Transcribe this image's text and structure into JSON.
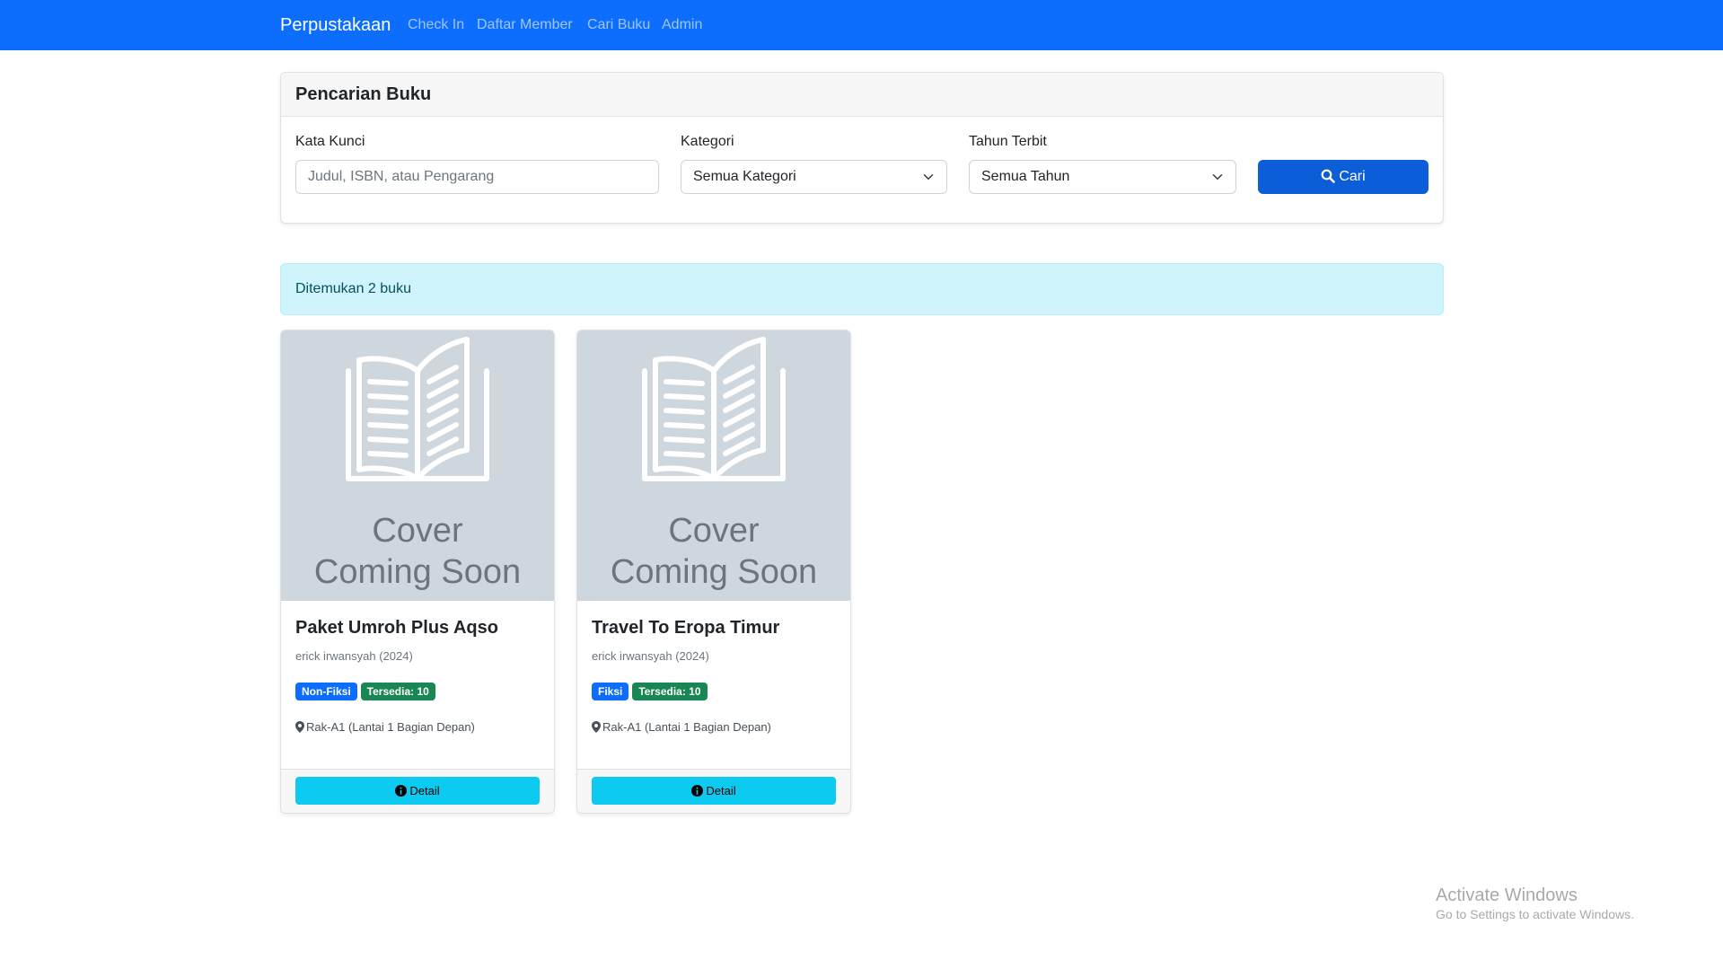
{
  "navbar": {
    "brand": "Perpustakaan",
    "links": [
      "Check In",
      "Daftar Member",
      "Cari Buku",
      "Admin"
    ]
  },
  "search": {
    "header": "Pencarian Buku",
    "keyword_label": "Kata Kunci",
    "keyword_placeholder": "Judul, ISBN, atau Pengarang",
    "keyword_value": "",
    "category_label": "Kategori",
    "category_selected": "Semua Kategori",
    "year_label": "Tahun Terbit",
    "year_selected": "Semua Tahun",
    "button_label": "Cari"
  },
  "result_alert": "Ditemukan 2 buku",
  "books": [
    {
      "cover_line1": "Cover",
      "cover_line2": "Coming Soon",
      "title": "Paket Umroh Plus Aqso",
      "meta": "erick irwansyah (2024)",
      "category": "Non-Fiksi",
      "availability": "Tersedia: 10",
      "location": "Rak-A1 (Lantai 1 Bagian Depan)",
      "detail_label": "Detail"
    },
    {
      "cover_line1": "Cover",
      "cover_line2": "Coming Soon",
      "title": "Travel To Eropa Timur",
      "meta": "erick irwansyah (2024)",
      "category": "Fiksi",
      "availability": "Tersedia: 10",
      "location": "Rak-A1 (Lantai 1 Bagian Depan)",
      "detail_label": "Detail"
    }
  ],
  "watermark": {
    "title": "Activate Windows",
    "subtitle": "Go to Settings to activate Windows."
  },
  "icons": {
    "search": "search-icon",
    "chevron": "chevron-down-icon",
    "book": "open-book-icon",
    "location": "map-marker-icon",
    "info": "info-circle-icon"
  },
  "colors": {
    "primary": "#0d6efd",
    "alert_bg": "#cff4fc",
    "badge_green": "#198754",
    "detail_button": "#0dcaf0",
    "cover_bg": "#ced6de"
  }
}
